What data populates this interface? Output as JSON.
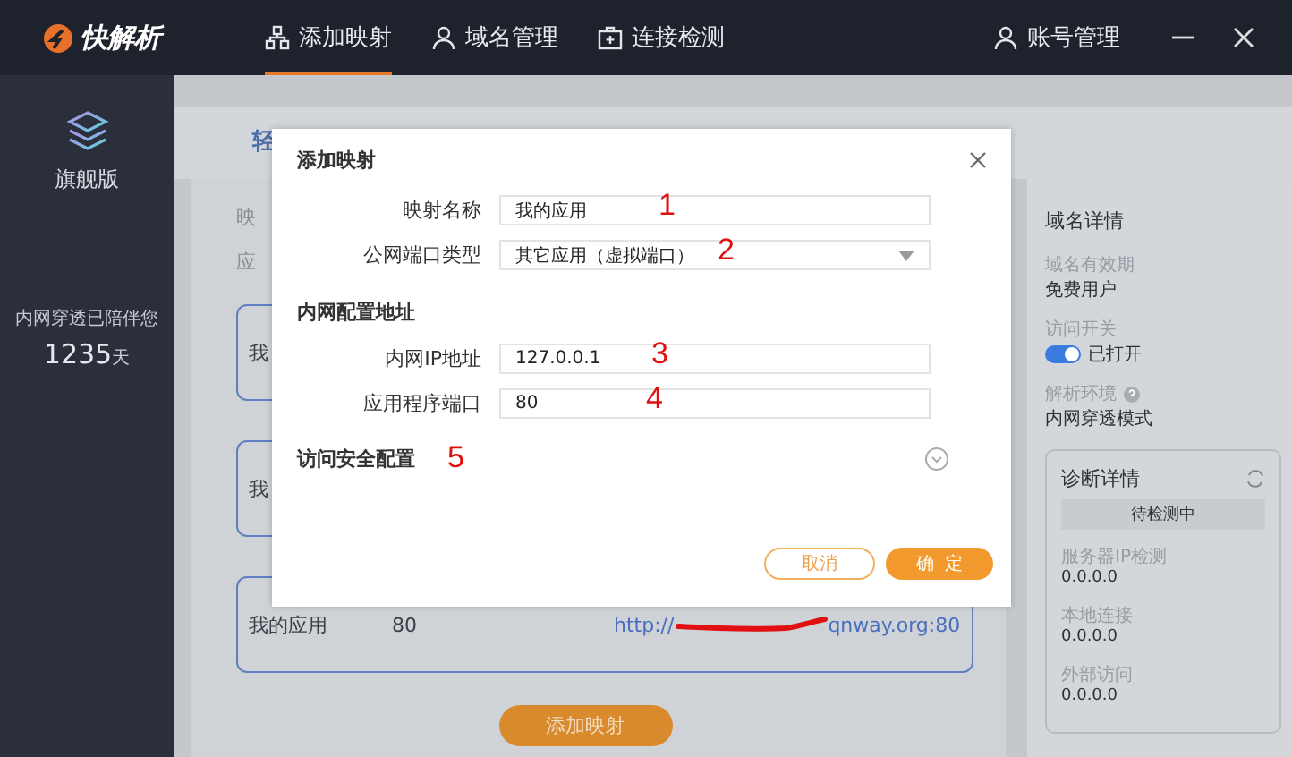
{
  "app": {
    "logo": "快解析"
  },
  "nav": [
    {
      "label": "添加映射",
      "selected": true
    },
    {
      "label": "域名管理",
      "selected": false
    },
    {
      "label": "连接检测",
      "selected": false
    }
  ],
  "account": "账号管理",
  "sidebar": {
    "edition": "旗舰版",
    "caption": "内网穿透已陪伴您",
    "days": "1235",
    "unit": "天"
  },
  "background": {
    "banner": "轻",
    "labels": [
      "映",
      "应"
    ],
    "mappings": [
      {
        "name": "我"
      },
      {
        "name": "我"
      },
      {
        "name": "我的应用",
        "port": "80",
        "url_start": "http://",
        "url_end": "qnway.org:80"
      }
    ],
    "add_button": "添加映射"
  },
  "details": {
    "title": "域名详情",
    "items": [
      {
        "kind": "text",
        "label": "域名有效期",
        "value": "免费用户"
      },
      {
        "kind": "switch",
        "label": "访问开关",
        "value": "已打开",
        "on": true
      },
      {
        "kind": "help",
        "label": "解析环境",
        "value": "内网穿透模式"
      }
    ],
    "diagnosis": {
      "title": "诊断详情",
      "status": "待检测中",
      "checks": [
        {
          "label": "服务器IP检测",
          "value": "0.0.0.0"
        },
        {
          "label": "本地连接",
          "value": "0.0.0.0"
        },
        {
          "label": "外部访问",
          "value": "0.0.0.0"
        }
      ]
    }
  },
  "dialog": {
    "title": "添加映射",
    "fields": [
      {
        "kind": "input",
        "label": "映射名称",
        "value": "我的应用",
        "note": "1"
      },
      {
        "kind": "select",
        "label": "公网端口类型",
        "value": "其它应用（虚拟端口）",
        "note": "2"
      }
    ],
    "section": "内网配置地址",
    "section_fields": [
      {
        "kind": "input",
        "label": "内网IP地址",
        "value": "127.0.0.1",
        "note": "3"
      },
      {
        "kind": "input",
        "label": "应用程序端口",
        "value": "80",
        "note": "4"
      }
    ],
    "security": {
      "title": "访问安全配置",
      "note": "5",
      "expanded": false
    },
    "cancel": "取消",
    "ok": "确  定"
  }
}
